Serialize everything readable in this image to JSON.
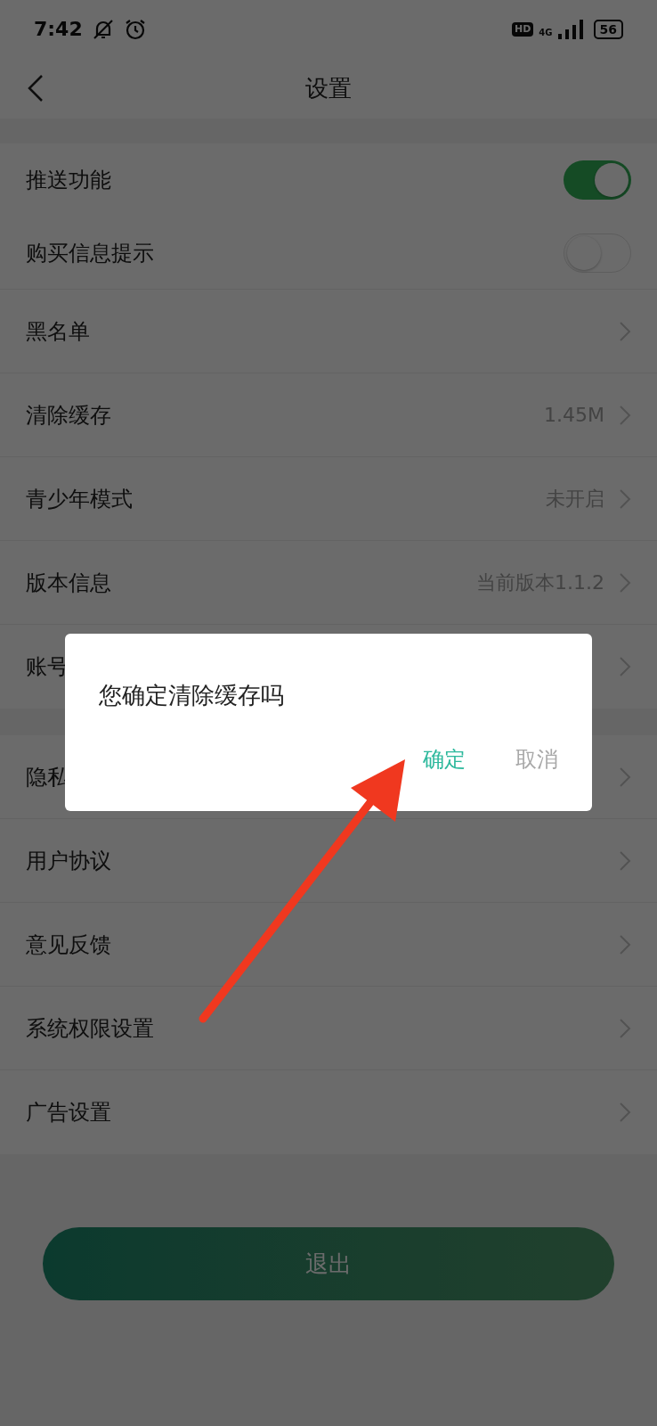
{
  "status_bar": {
    "time": "7:42",
    "network_badge": "HD",
    "network_type": "4G",
    "battery": "56"
  },
  "header": {
    "title": "设置"
  },
  "groups": [
    {
      "rows": [
        {
          "kind": "toggle",
          "label": "推送功能",
          "on": true
        },
        {
          "kind": "toggle",
          "label": "购买信息提示",
          "on": false
        },
        {
          "kind": "link",
          "label": "黑名单"
        },
        {
          "kind": "link",
          "label": "清除缓存",
          "value": "1.45M"
        },
        {
          "kind": "link",
          "label": "青少年模式",
          "value": "未开启"
        },
        {
          "kind": "link",
          "label": "版本信息",
          "value": "当前版本1.1.2"
        },
        {
          "kind": "link",
          "label": "账号"
        }
      ]
    },
    {
      "rows": [
        {
          "kind": "link",
          "label": "隐私"
        },
        {
          "kind": "link",
          "label": "用户协议"
        },
        {
          "kind": "link",
          "label": "意见反馈"
        },
        {
          "kind": "link",
          "label": "系统权限设置"
        },
        {
          "kind": "link",
          "label": "广告设置"
        }
      ]
    }
  ],
  "exit_button": "退出",
  "dialog": {
    "message": "您确定清除缓存吗",
    "buttons": [
      {
        "label": "确定",
        "kind": "primary"
      },
      {
        "label": "取消",
        "kind": "secondary"
      }
    ]
  }
}
